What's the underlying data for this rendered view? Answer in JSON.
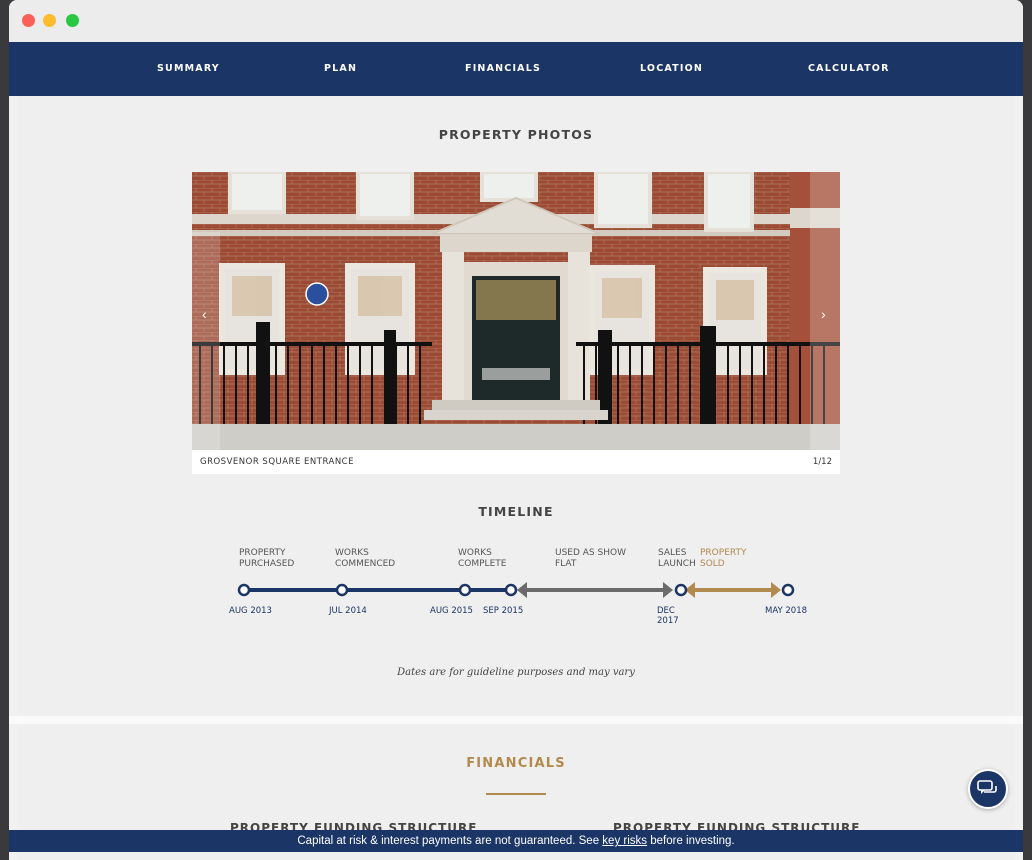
{
  "nav": {
    "items": [
      "SUMMARY",
      "PLAN",
      "FINANCIALS",
      "LOCATION",
      "CALCULATOR"
    ]
  },
  "photos": {
    "heading": "PROPERTY PHOTOS",
    "caption": "GROSVENOR SQUARE ENTRANCE",
    "counter": "1/12"
  },
  "timeline": {
    "heading": "TIMELINE",
    "labels": [
      {
        "text": "PROPERTY\nPURCHASED"
      },
      {
        "text": "WORKS\nCOMMENCED"
      },
      {
        "text": "WORKS\nCOMPLETE"
      },
      {
        "text": "USED AS SHOW\nFLAT"
      },
      {
        "text": "SALES\nLAUNCH"
      },
      {
        "text": "PROPERTY\nSOLD"
      }
    ],
    "dates": [
      "AUG 2013",
      "JUL 2014",
      "AUG 2015",
      "SEP 2015",
      "DEC\n2017",
      "MAY 2018"
    ],
    "note": "Dates are for guideline purposes and may vary"
  },
  "financials": {
    "heading": "FINANCIALS",
    "left_sub": "PROPERTY FUNDING STRUCTURE",
    "right_sub": "PROPERTY FUNDING STRUCTURE"
  },
  "footer": {
    "before": "Capital at risk & interest payments are not guaranteed. See ",
    "link": "key risks",
    "after": " before investing."
  },
  "colors": {
    "navy": "#1b3566",
    "gold": "#b38a4e",
    "grey_arrow": "#6b6b6b"
  },
  "icons": {
    "chat": "chat-icon",
    "prev": "chevron-left-icon",
    "next": "chevron-right-icon"
  }
}
